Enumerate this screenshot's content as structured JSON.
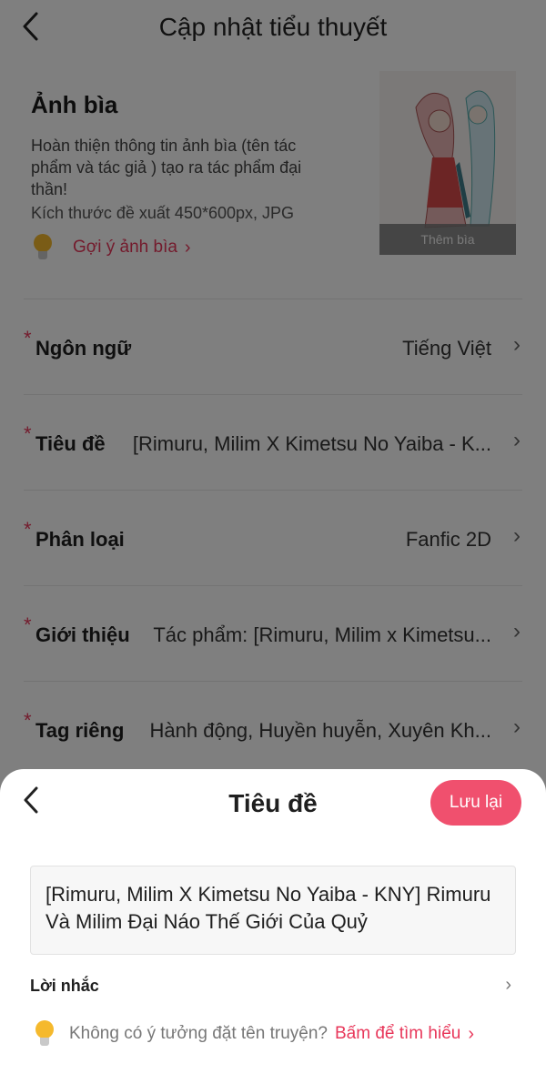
{
  "header": {
    "back_icon": "chevron-left-icon",
    "title": "Cập nhật tiểu thuyết"
  },
  "cover": {
    "title": "Ảnh bìa",
    "description": "Hoàn thiện thông tin ảnh bìa (tên tác phẩm và tác giả ) tạo ra tác phẩm đại thần!",
    "size_hint": "Kích thước đề xuất 450*600px, JPG",
    "tip_icon": "lightbulb-icon",
    "tip_text": "Gợi ý ảnh bìa",
    "add_cover_label": "Thêm bìa"
  },
  "form": {
    "rows": [
      {
        "label": "Ngôn ngữ",
        "value": "Tiếng Việt",
        "required": "*"
      },
      {
        "label": "Tiêu đề",
        "value": "[Rimuru, Milim X Kimetsu No Yaiba - K...",
        "required": "*"
      },
      {
        "label": "Phân loại",
        "value": "Fanfic 2D",
        "required": "*"
      },
      {
        "label": "Giới thiệu",
        "value": "Tác phẩm: [Rimuru, Milim x Kimetsu...",
        "required": "*"
      },
      {
        "label": "Tag riêng",
        "value": "Hành động, Huyền huyễn, Xuyên Kh...",
        "required": "*"
      }
    ]
  },
  "sheet": {
    "title": "Tiêu đề",
    "save_label": "Lưu lại",
    "title_value": "[Rimuru, Milim X Kimetsu No Yaiba - KNY] Rimuru Và Milim Đại Náo Thế Giới Của Quỷ",
    "reminder_label": "Lời nhắc",
    "hint_text": "Không có ý tưởng đặt tên truyện?",
    "hint_link": "Bấm để tìm hiểu"
  },
  "colors": {
    "accent": "#e8375a",
    "button": "#f0506e",
    "overlay": "rgba(0,0,0,0.5)"
  }
}
